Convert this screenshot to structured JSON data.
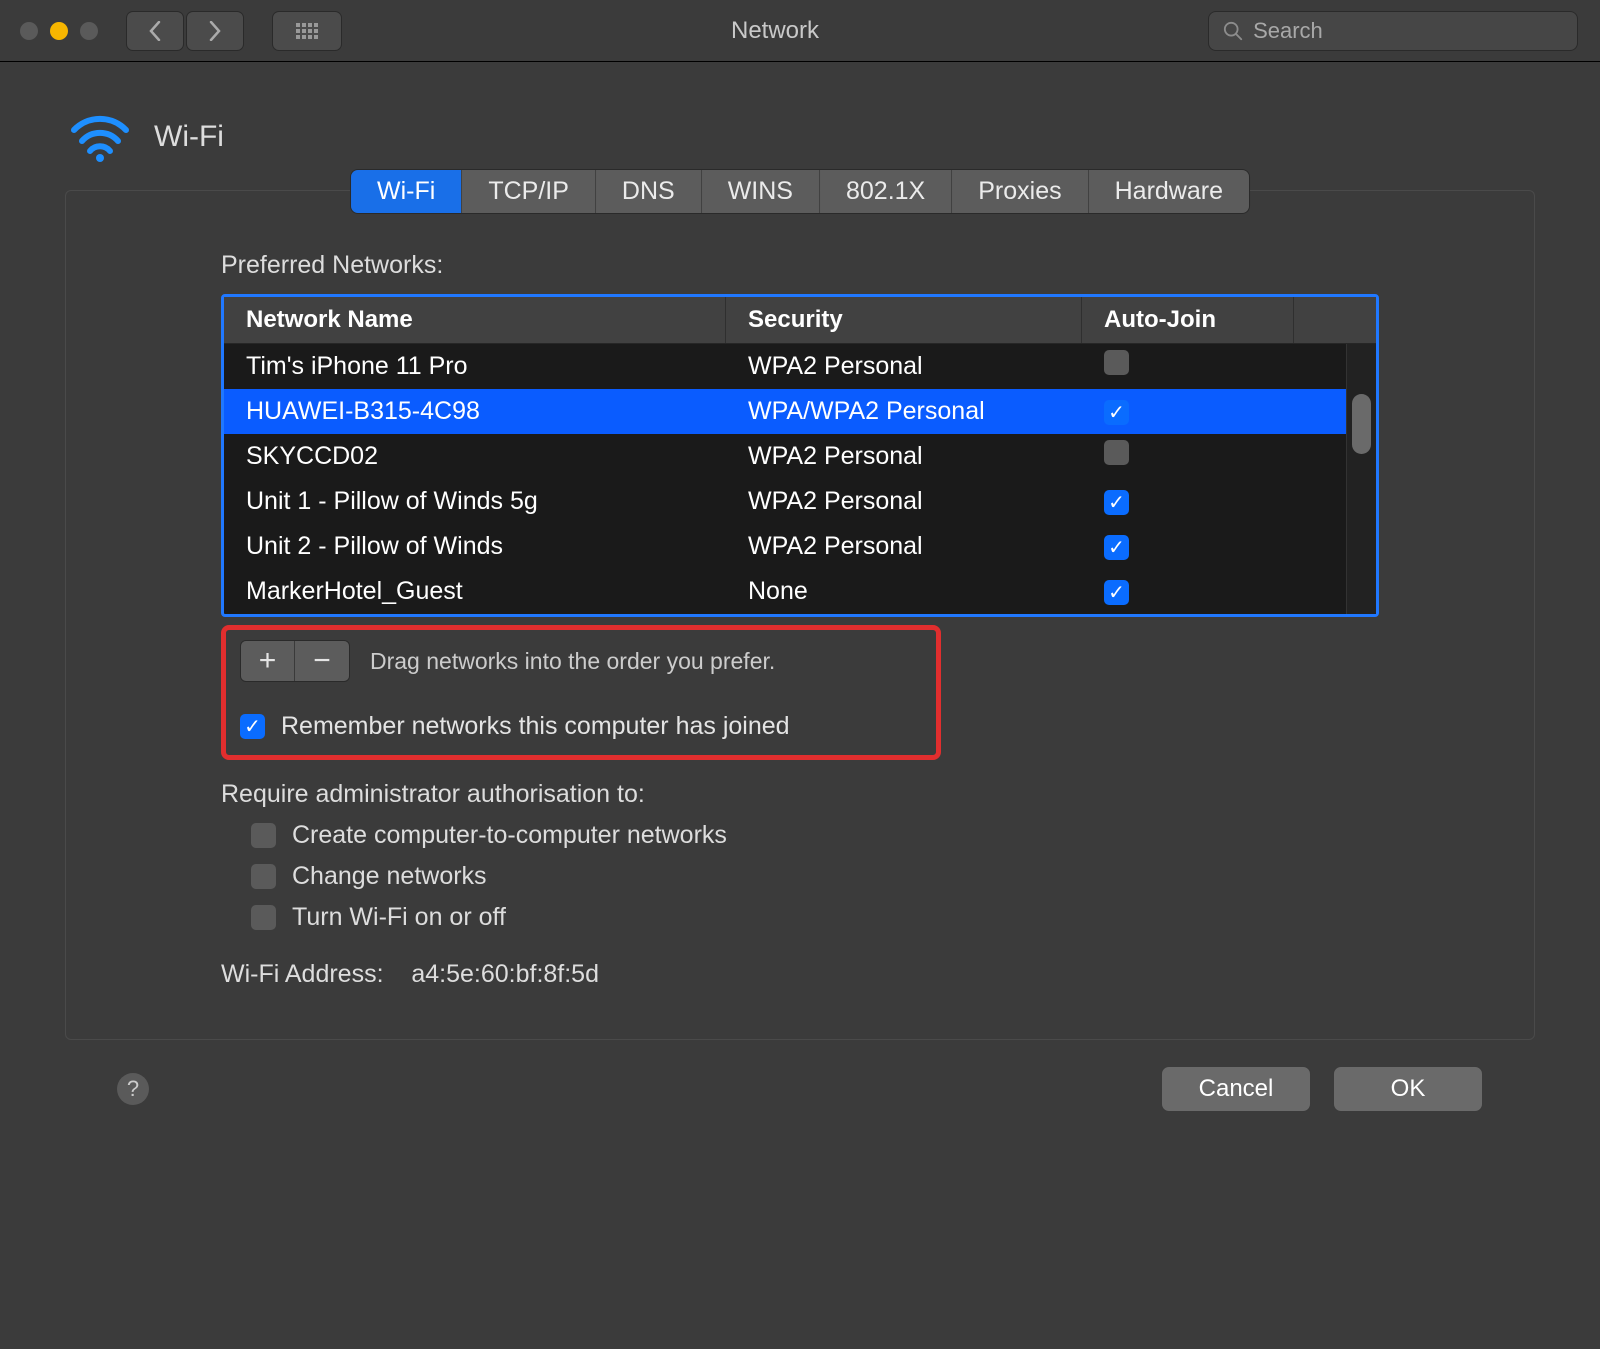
{
  "titlebar": {
    "title": "Network",
    "search_placeholder": "Search"
  },
  "panel": {
    "title": "Wi-Fi"
  },
  "tabs": [
    {
      "label": "Wi-Fi",
      "active": true
    },
    {
      "label": "TCP/IP",
      "active": false
    },
    {
      "label": "DNS",
      "active": false
    },
    {
      "label": "WINS",
      "active": false
    },
    {
      "label": "802.1X",
      "active": false
    },
    {
      "label": "Proxies",
      "active": false
    },
    {
      "label": "Hardware",
      "active": false
    }
  ],
  "preferred_label": "Preferred Networks:",
  "columns": {
    "name": "Network Name",
    "security": "Security",
    "autojoin": "Auto-Join"
  },
  "networks": [
    {
      "name": "Tim's iPhone 11 Pro",
      "security": "WPA2 Personal",
      "autojoin": false,
      "selected": false
    },
    {
      "name": "HUAWEI-B315-4C98",
      "security": "WPA/WPA2 Personal",
      "autojoin": true,
      "selected": true
    },
    {
      "name": "SKYCCD02",
      "security": "WPA2 Personal",
      "autojoin": false,
      "selected": false
    },
    {
      "name": "Unit 1 - Pillow of Winds 5g",
      "security": "WPA2 Personal",
      "autojoin": true,
      "selected": false
    },
    {
      "name": "Unit 2 - Pillow of Winds",
      "security": "WPA2 Personal",
      "autojoin": true,
      "selected": false
    },
    {
      "name": "MarkerHotel_Guest",
      "security": "None",
      "autojoin": true,
      "selected": false
    }
  ],
  "drag_hint": "Drag networks into the order you prefer.",
  "remember_label": "Remember networks this computer has joined",
  "remember_checked": true,
  "authz": {
    "heading": "Require administrator authorisation to:",
    "items": [
      {
        "label": "Create computer-to-computer networks",
        "checked": false
      },
      {
        "label": "Change networks",
        "checked": false
      },
      {
        "label": "Turn Wi-Fi on or off",
        "checked": false
      }
    ]
  },
  "wifi_address": {
    "label": "Wi-Fi Address:",
    "value": "a4:5e:60:bf:8f:5d"
  },
  "buttons": {
    "cancel": "Cancel",
    "ok": "OK"
  }
}
